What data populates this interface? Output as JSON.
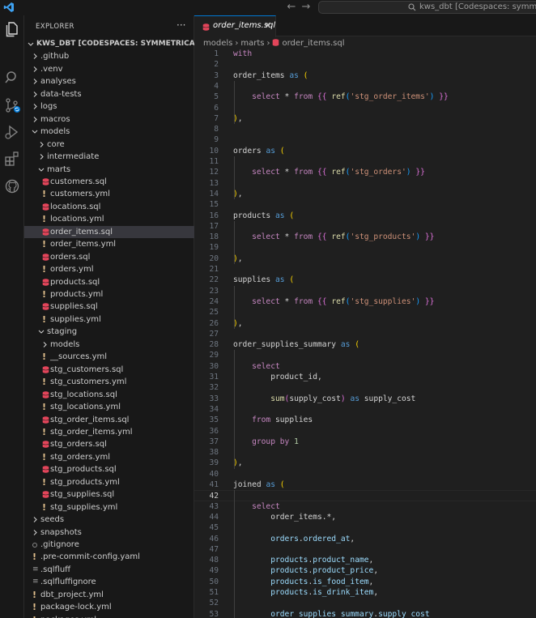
{
  "titlebar": {
    "search_text": "kws_dbt [Codespaces: symmetrical system]"
  },
  "activity": [
    "explorer-icon",
    "search-icon",
    "source-control-icon",
    "run-debug-icon",
    "extensions-icon",
    "github-icon"
  ],
  "sidebar": {
    "title": "EXPLORER",
    "more": "···",
    "items": [
      {
        "label": "KWS_DBT [CODESPACES: SYMMETRICAL SYSTEM]",
        "type": "root",
        "depth": 0,
        "open": true
      },
      {
        "label": ".github",
        "type": "folder",
        "depth": 1,
        "open": false
      },
      {
        "label": ".venv",
        "type": "folder",
        "depth": 1,
        "open": false
      },
      {
        "label": "analyses",
        "type": "folder",
        "depth": 1,
        "open": false
      },
      {
        "label": "data-tests",
        "type": "folder",
        "depth": 1,
        "open": false
      },
      {
        "label": "logs",
        "type": "folder",
        "depth": 1,
        "open": false
      },
      {
        "label": "macros",
        "type": "folder",
        "depth": 1,
        "open": false
      },
      {
        "label": "models",
        "type": "folder",
        "depth": 1,
        "open": true
      },
      {
        "label": "core",
        "type": "folder",
        "depth": 2,
        "open": false
      },
      {
        "label": "intermediate",
        "type": "folder",
        "depth": 2,
        "open": false
      },
      {
        "label": "marts",
        "type": "folder",
        "depth": 2,
        "open": true
      },
      {
        "label": "customers.sql",
        "type": "sql",
        "depth": 3
      },
      {
        "label": "customers.yml",
        "type": "yml",
        "depth": 3
      },
      {
        "label": "locations.sql",
        "type": "sql",
        "depth": 3
      },
      {
        "label": "locations.yml",
        "type": "yml",
        "depth": 3
      },
      {
        "label": "order_items.sql",
        "type": "sql",
        "depth": 3,
        "selected": true
      },
      {
        "label": "order_items.yml",
        "type": "yml",
        "depth": 3
      },
      {
        "label": "orders.sql",
        "type": "sql",
        "depth": 3
      },
      {
        "label": "orders.yml",
        "type": "yml",
        "depth": 3
      },
      {
        "label": "products.sql",
        "type": "sql",
        "depth": 3
      },
      {
        "label": "products.yml",
        "type": "yml",
        "depth": 3
      },
      {
        "label": "supplies.sql",
        "type": "sql",
        "depth": 3
      },
      {
        "label": "supplies.yml",
        "type": "yml",
        "depth": 3
      },
      {
        "label": "staging",
        "type": "folder",
        "depth": 2,
        "open": true
      },
      {
        "label": "models",
        "type": "folder",
        "depth": 3,
        "open": false
      },
      {
        "label": "__sources.yml",
        "type": "yml",
        "depth": 3
      },
      {
        "label": "stg_customers.sql",
        "type": "sql",
        "depth": 3
      },
      {
        "label": "stg_customers.yml",
        "type": "yml",
        "depth": 3
      },
      {
        "label": "stg_locations.sql",
        "type": "sql",
        "depth": 3
      },
      {
        "label": "stg_locations.yml",
        "type": "yml",
        "depth": 3
      },
      {
        "label": "stg_order_items.sql",
        "type": "sql",
        "depth": 3
      },
      {
        "label": "stg_order_items.yml",
        "type": "yml",
        "depth": 3
      },
      {
        "label": "stg_orders.sql",
        "type": "sql",
        "depth": 3
      },
      {
        "label": "stg_orders.yml",
        "type": "yml",
        "depth": 3
      },
      {
        "label": "stg_products.sql",
        "type": "sql",
        "depth": 3
      },
      {
        "label": "stg_products.yml",
        "type": "yml",
        "depth": 3
      },
      {
        "label": "stg_supplies.sql",
        "type": "sql",
        "depth": 3
      },
      {
        "label": "stg_supplies.yml",
        "type": "yml",
        "depth": 3
      },
      {
        "label": "seeds",
        "type": "folder",
        "depth": 1,
        "open": false
      },
      {
        "label": "snapshots",
        "type": "folder",
        "depth": 1,
        "open": false
      },
      {
        "label": ".gitignore",
        "type": "git",
        "depth": 1
      },
      {
        "label": ".pre-commit-config.yaml",
        "type": "yml",
        "depth": 1
      },
      {
        "label": ".sqlfluff",
        "type": "cfg",
        "depth": 1
      },
      {
        "label": ".sqlfluffignore",
        "type": "cfg",
        "depth": 1
      },
      {
        "label": "dbt_project.yml",
        "type": "yml",
        "depth": 1
      },
      {
        "label": "package-lock.yml",
        "type": "yml",
        "depth": 1
      },
      {
        "label": "packages.yml",
        "type": "yml",
        "depth": 1
      }
    ]
  },
  "editor": {
    "tab_label": "order_items.sql",
    "breadcrumb": [
      "models",
      "marts",
      "order_items.sql"
    ],
    "current_line": 42,
    "lines": [
      [
        [
          "kw",
          "with"
        ]
      ],
      [],
      [
        [
          "id",
          "order_items "
        ],
        [
          "kw2",
          "as"
        ],
        [
          "id",
          " "
        ],
        [
          "br1",
          "("
        ]
      ],
      [],
      [
        [
          "id",
          "    "
        ],
        [
          "kw",
          "select"
        ],
        [
          "id",
          " * "
        ],
        [
          "kw",
          "from"
        ],
        [
          "id",
          " "
        ],
        [
          "br2",
          "{{"
        ],
        [
          "id",
          " "
        ],
        [
          "fn",
          "ref"
        ],
        [
          "br3",
          "("
        ],
        [
          "str",
          "'stg_order_items'"
        ],
        [
          "br3",
          ")"
        ],
        [
          "id",
          " "
        ],
        [
          "br2",
          "}}"
        ]
      ],
      [],
      [
        [
          "br1",
          ")"
        ],
        [
          "id",
          ","
        ]
      ],
      [],
      [],
      [
        [
          "id",
          "orders "
        ],
        [
          "kw2",
          "as"
        ],
        [
          "id",
          " "
        ],
        [
          "br1",
          "("
        ]
      ],
      [],
      [
        [
          "id",
          "    "
        ],
        [
          "kw",
          "select"
        ],
        [
          "id",
          " * "
        ],
        [
          "kw",
          "from"
        ],
        [
          "id",
          " "
        ],
        [
          "br2",
          "{{"
        ],
        [
          "id",
          " "
        ],
        [
          "fn",
          "ref"
        ],
        [
          "br3",
          "("
        ],
        [
          "str",
          "'stg_orders'"
        ],
        [
          "br3",
          ")"
        ],
        [
          "id",
          " "
        ],
        [
          "br2",
          "}}"
        ]
      ],
      [],
      [
        [
          "br1",
          ")"
        ],
        [
          "id",
          ","
        ]
      ],
      [],
      [
        [
          "id",
          "products "
        ],
        [
          "kw2",
          "as"
        ],
        [
          "id",
          " "
        ],
        [
          "br1",
          "("
        ]
      ],
      [],
      [
        [
          "id",
          "    "
        ],
        [
          "kw",
          "select"
        ],
        [
          "id",
          " * "
        ],
        [
          "kw",
          "from"
        ],
        [
          "id",
          " "
        ],
        [
          "br2",
          "{{"
        ],
        [
          "id",
          " "
        ],
        [
          "fn",
          "ref"
        ],
        [
          "br3",
          "("
        ],
        [
          "str",
          "'stg_products'"
        ],
        [
          "br3",
          ")"
        ],
        [
          "id",
          " "
        ],
        [
          "br2",
          "}}"
        ]
      ],
      [],
      [
        [
          "br1",
          ")"
        ],
        [
          "id",
          ","
        ]
      ],
      [],
      [
        [
          "id",
          "supplies "
        ],
        [
          "kw2",
          "as"
        ],
        [
          "id",
          " "
        ],
        [
          "br1",
          "("
        ]
      ],
      [],
      [
        [
          "id",
          "    "
        ],
        [
          "kw",
          "select"
        ],
        [
          "id",
          " * "
        ],
        [
          "kw",
          "from"
        ],
        [
          "id",
          " "
        ],
        [
          "br2",
          "{{"
        ],
        [
          "id",
          " "
        ],
        [
          "fn",
          "ref"
        ],
        [
          "br3",
          "("
        ],
        [
          "str",
          "'stg_supplies'"
        ],
        [
          "br3",
          ")"
        ],
        [
          "id",
          " "
        ],
        [
          "br2",
          "}}"
        ]
      ],
      [],
      [
        [
          "br1",
          ")"
        ],
        [
          "id",
          ","
        ]
      ],
      [],
      [
        [
          "id",
          "order_supplies_summary "
        ],
        [
          "kw2",
          "as"
        ],
        [
          "id",
          " "
        ],
        [
          "br1",
          "("
        ]
      ],
      [],
      [
        [
          "id",
          "    "
        ],
        [
          "kw",
          "select"
        ]
      ],
      [
        [
          "id",
          "        product_id,"
        ]
      ],
      [],
      [
        [
          "id",
          "        "
        ],
        [
          "fn",
          "sum"
        ],
        [
          "br2",
          "("
        ],
        [
          "id",
          "supply_cost"
        ],
        [
          "br2",
          ")"
        ],
        [
          "id",
          " "
        ],
        [
          "kw2",
          "as"
        ],
        [
          "id",
          " supply_cost"
        ]
      ],
      [],
      [
        [
          "id",
          "    "
        ],
        [
          "kw",
          "from"
        ],
        [
          "id",
          " supplies"
        ]
      ],
      [],
      [
        [
          "id",
          "    "
        ],
        [
          "kw",
          "group by"
        ],
        [
          "id",
          " "
        ],
        [
          "num",
          "1"
        ]
      ],
      [],
      [
        [
          "br1",
          ")"
        ],
        [
          "id",
          ","
        ]
      ],
      [],
      [
        [
          "id",
          "joined "
        ],
        [
          "kw2",
          "as"
        ],
        [
          "id",
          " "
        ],
        [
          "br1",
          "("
        ]
      ],
      [],
      [
        [
          "id",
          "    "
        ],
        [
          "kw",
          "select"
        ]
      ],
      [
        [
          "id",
          "        order_items.*,"
        ]
      ],
      [],
      [
        [
          "id",
          "        "
        ],
        [
          "var",
          "orders"
        ],
        [
          "id",
          "."
        ],
        [
          "var",
          "ordered_at"
        ],
        [
          "id",
          ","
        ]
      ],
      [],
      [
        [
          "id",
          "        "
        ],
        [
          "var",
          "products"
        ],
        [
          "id",
          "."
        ],
        [
          "var",
          "product_name"
        ],
        [
          "id",
          ","
        ]
      ],
      [
        [
          "id",
          "        "
        ],
        [
          "var",
          "products"
        ],
        [
          "id",
          "."
        ],
        [
          "var",
          "product_price"
        ],
        [
          "id",
          ","
        ]
      ],
      [
        [
          "id",
          "        "
        ],
        [
          "var",
          "products"
        ],
        [
          "id",
          "."
        ],
        [
          "var",
          "is_food_item"
        ],
        [
          "id",
          ","
        ]
      ],
      [
        [
          "id",
          "        "
        ],
        [
          "var",
          "products"
        ],
        [
          "id",
          "."
        ],
        [
          "var",
          "is_drink_item"
        ],
        [
          "id",
          ","
        ]
      ],
      [],
      [
        [
          "id",
          "        "
        ],
        [
          "var",
          "order_supplies_summary"
        ],
        [
          "id",
          "."
        ],
        [
          "var",
          "supply_cost"
        ]
      ]
    ]
  },
  "colors": {
    "accent": "#0078d4",
    "sql_icon": "#e2455a",
    "yml_icon": "#e2c08d"
  }
}
